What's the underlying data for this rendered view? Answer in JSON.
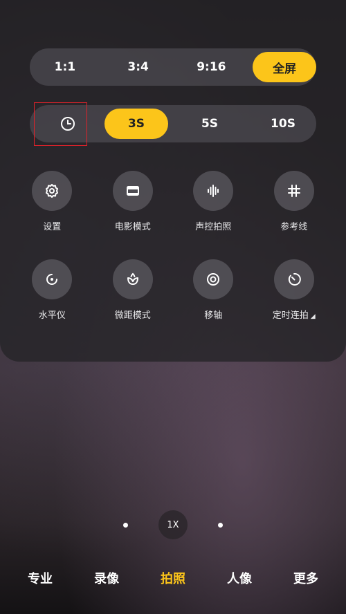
{
  "aspect_ratio": {
    "options": [
      "1:1",
      "3:4",
      "9:16",
      "全屏"
    ],
    "selected": "全屏"
  },
  "timer": {
    "icon": "clock-icon",
    "options": [
      "3S",
      "5S",
      "10S"
    ],
    "selected": "3S"
  },
  "tools_row1": [
    {
      "label": "设置",
      "icon": "gear-icon"
    },
    {
      "label": "电影模式",
      "icon": "movie-frame-icon"
    },
    {
      "label": "声控拍照",
      "icon": "sound-wave-icon"
    },
    {
      "label": "参考线",
      "icon": "grid-hash-icon"
    }
  ],
  "tools_row2": [
    {
      "label": "水平仪",
      "icon": "level-icon"
    },
    {
      "label": "微距模式",
      "icon": "macro-flower-icon"
    },
    {
      "label": "移轴",
      "icon": "tilt-shift-icon"
    },
    {
      "label": "定时连拍",
      "icon": "timer-burst-icon"
    }
  ],
  "zoom": {
    "label": "1X"
  },
  "modes": {
    "items": [
      "专业",
      "录像",
      "拍照",
      "人像",
      "更多"
    ],
    "selected": "拍照"
  },
  "colors": {
    "accent": "#fcc51a",
    "highlight_box": "#e0222a"
  }
}
